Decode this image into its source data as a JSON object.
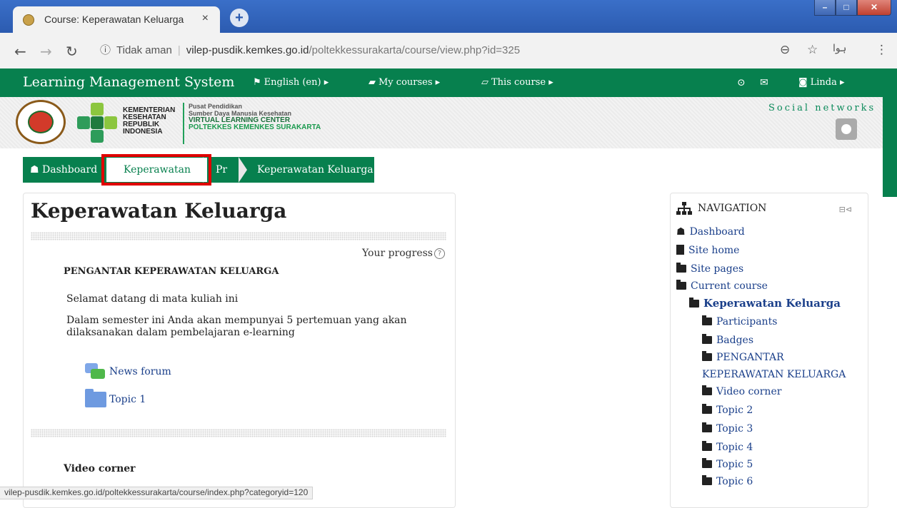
{
  "browser": {
    "tab_title": "Course: Keperawatan Keluarga",
    "tab_close": "×",
    "new_tab": "+",
    "security_label": "Tidak aman",
    "url_domain": "vilep-pusdik.kemkes.go.id",
    "url_path": "/poltekkessurakarta/course/view.php?id=325",
    "profile_text": "ہوا"
  },
  "navbar": {
    "brand": "Learning Management System",
    "menus": [
      "English (en)",
      "My courses",
      "This course"
    ],
    "user": "Linda"
  },
  "header": {
    "kemkes_lines": [
      "KEMENTERIAN",
      "KESEHATAN",
      "REPUBLIK",
      "INDONESIA"
    ],
    "pusat_lines": [
      "Pusat Pendidikan",
      "Sumber Daya Manusia Kesehatan",
      "VIRTUAL LEARNING CENTER",
      "POLTEKKES KEMENKES SURAKARTA"
    ],
    "social": "Social networks"
  },
  "breadcrumb": [
    "Dashboard",
    "Keperawatan",
    "Pr",
    "Keperawatan Keluarga"
  ],
  "main": {
    "title": "Keperawatan Keluarga",
    "progress_label": "Your progress",
    "section_title": "PENGANTAR KEPERAWATAN KELUARGA",
    "welcome": "Selamat datang di mata kuliah ini",
    "desc_line1": "Dalam semester ini Anda akan mempunyai 5 pertemuan yang akan",
    "desc_line2": "dilaksanakan dalam pembelajaran e-learning",
    "activities": [
      "News forum",
      "Topic 1"
    ],
    "video_corner": "Video corner"
  },
  "navigation": {
    "title": "NAVIGATION",
    "dashboard": "Dashboard",
    "site_home": "Site home",
    "site_pages": "Site pages",
    "current_course": "Current course",
    "course_name": "Keperawatan Keluarga",
    "children": [
      "Participants",
      "Badges",
      "PENGANTAR",
      "KEPERAWATAN KELUARGA",
      "Video corner",
      "Topic 2",
      "Topic 3",
      "Topic 4",
      "Topic 5",
      "Topic 6"
    ]
  },
  "status_url": "vilep-pusdik.kemkes.go.id/poltekkessurakarta/course/index.php?categoryid=120"
}
